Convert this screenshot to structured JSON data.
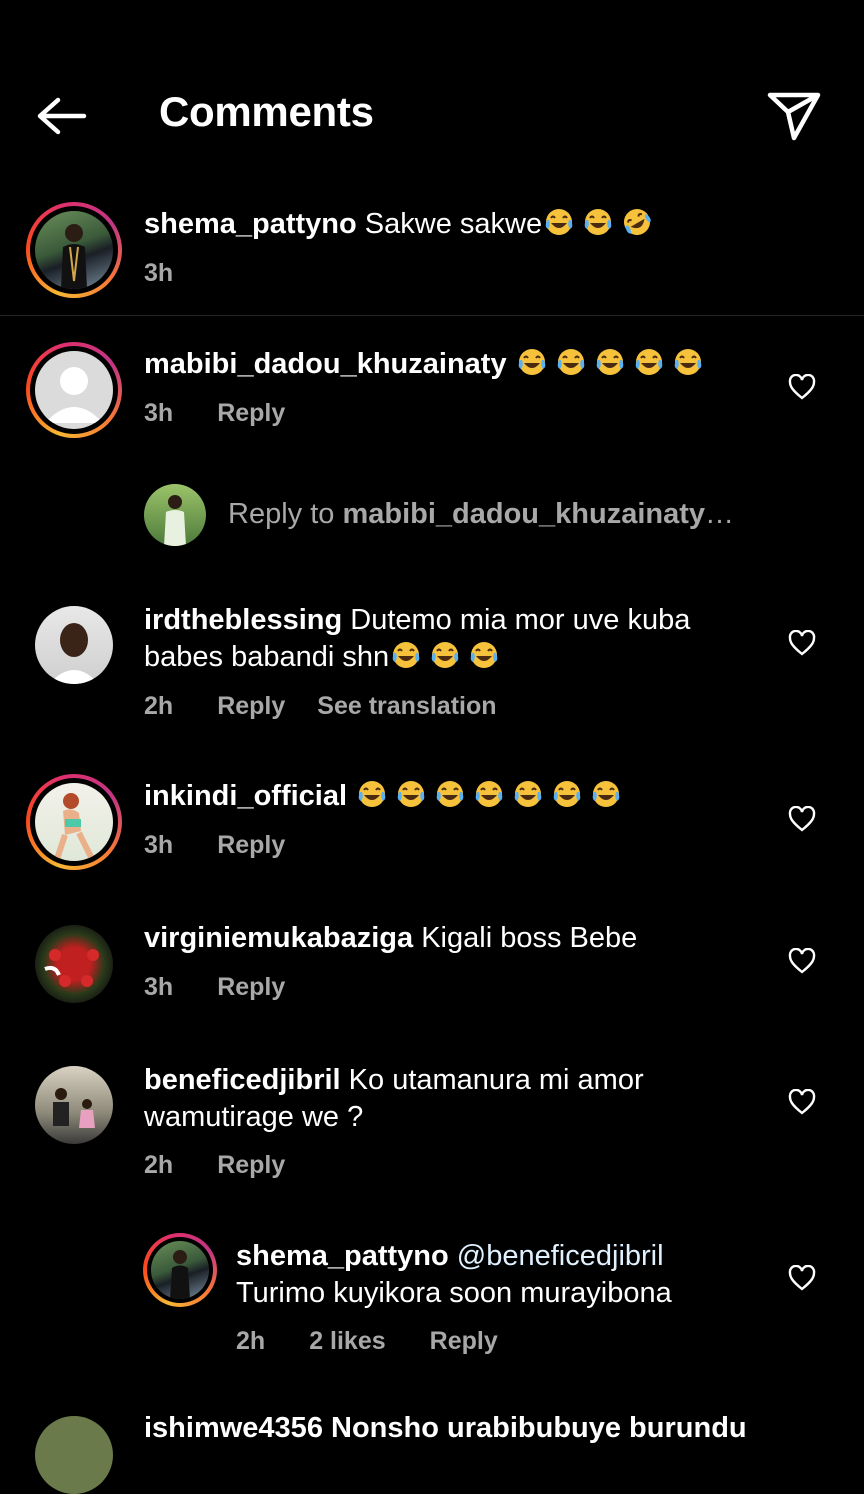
{
  "header": {
    "title": "Comments"
  },
  "caption": {
    "username": "shema_pattyno",
    "text": " Sakwe sakwe",
    "emojis": [
      "joy",
      "joy",
      "rofl"
    ],
    "time": "3h"
  },
  "comments": [
    {
      "username": "mabibi_dadou_khuzainaty",
      "text": " ",
      "emojis": [
        "joy",
        "joy",
        "joy",
        "joy",
        "joy"
      ],
      "time": "3h",
      "reply_label": "Reply"
    },
    {
      "username": "irdtheblessing",
      "text": " Dutemo mia mor uve kuba",
      "text2": "babes babandi shn",
      "emojis2": [
        "joy",
        "joy",
        "joy"
      ],
      "time": "2h",
      "reply_label": "Reply",
      "translate_label": "See translation"
    },
    {
      "username": "inkindi_official",
      "text": " ",
      "emojis": [
        "joy",
        "joy",
        "joy",
        "joy",
        "joy",
        "joy",
        "joy"
      ],
      "time": "3h",
      "reply_label": "Reply"
    },
    {
      "username": "virginiemukabaziga",
      "text": " Kigali boss Bebe",
      "time": "3h",
      "reply_label": "Reply"
    },
    {
      "username": "beneficedjibril",
      "text": " Ko utamanura mi amor",
      "text2": "wamutirage we ?",
      "time": "2h",
      "reply_label": "Reply"
    }
  ],
  "reply_prompt": {
    "prefix": "Reply to ",
    "target": "mabibi_dadou_khuzainaty",
    "ellipsis": "…"
  },
  "nested_reply": {
    "username": "shema_pattyno",
    "mention": " @beneficedjibril",
    "text": "Turimo kuyikora soon murayibona",
    "time": "2h",
    "likes": "2 likes",
    "reply_label": "Reply"
  },
  "partial": {
    "text": "ishimwe4356 Nonsho urabibubuye burundu"
  }
}
